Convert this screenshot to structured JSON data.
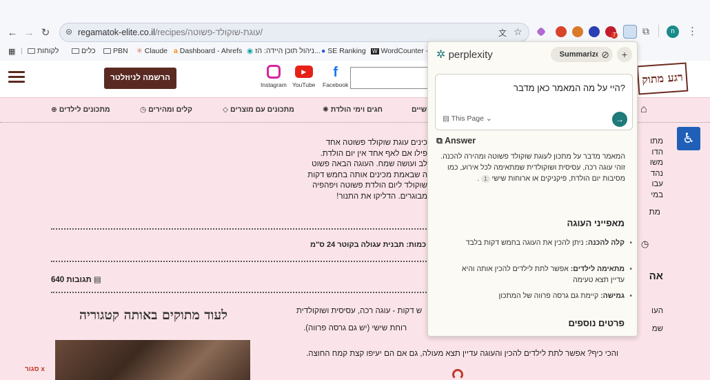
{
  "browser": {
    "url_domain": "regamatok-elite.co.il",
    "url_path": "/recipes/עוגת-שוקולד-פשוטה/",
    "profile_initial": "n",
    "ext_badge": "7",
    "bookmarks": [
      {
        "label": "לקוחות",
        "type": "folder"
      },
      {
        "label": "כלים",
        "type": "folder"
      },
      {
        "label": "PBN",
        "type": "folder"
      },
      {
        "label": "Claude",
        "type": "site"
      },
      {
        "label": "Dashboard - Ahrefs",
        "type": "site"
      },
      {
        "label": "ניהול תוכן היידה: הז...",
        "type": "site"
      },
      {
        "label": "SE Ranking",
        "type": "site"
      },
      {
        "label": "WordCounter - C",
        "type": "site"
      }
    ]
  },
  "site": {
    "signup_label": "הרשמה לניוזלטר",
    "logo_text": "רגע מתוק",
    "social": [
      {
        "label": "Instagram",
        "icon": "instagram-icon",
        "color": "#d6249f"
      },
      {
        "label": "YouTube",
        "icon": "youtube-icon",
        "color": "#e62117"
      },
      {
        "label": "Facebook",
        "icon": "facebook-icon",
        "color": "#1877f2"
      }
    ],
    "categories": [
      {
        "label": "מתכונים לילדים",
        "icon": "kids-icon"
      },
      {
        "label": "קלים ומהירים",
        "icon": "clock-icon"
      },
      {
        "label": "מתכונים עם מוצרים",
        "icon": "diamond-icon"
      },
      {
        "label": "חגים וימי הולדת",
        "icon": "party-icon"
      },
      {
        "label": "שיים",
        "icon": ""
      }
    ],
    "intro_lines": [
      "כינים עוגת שוקולד פשוטה אחד",
      "פילו אם לאף אחד אין יום הולדת.",
      "לב ועושה שמח. העוגה הבאה פשוט",
      "ה שבאמת מכינים אותה בחמש דקות",
      "שוקולד ליום הולדת פשוטה ויפהפיה",
      "מבוגרים. הדליקו את התנור!"
    ],
    "left_edge_lines": [
      "מתו",
      "הדו",
      "משו",
      "נהד",
      "עבו",
      "במי"
    ],
    "edge_mat": "מת",
    "edge_a": "אה",
    "edge_ha": "העו",
    "edge_shm": "שמ",
    "pan_label": "כמות: תבנית עגולה בקוטר 24 ס\"מ",
    "comments_label": "640 תגובות",
    "more_header": "לעוד מתוקים באותה קטגוריה",
    "body_line1": "ש דקות - עוגה רכה, עסיסית ושוקולדית",
    "body_line2": "רוחת שישי (יש גם גרסה פרווה).",
    "body_line3": "והכי כיף? אפשר לתת לילדים להכין והעוגה עדיין תצא מעולה, גם אם הם יעיפו קצת קמח החוצה.",
    "close_label": "סגור x"
  },
  "perplexity": {
    "brand": "perplexity",
    "summarize_label": "Summarize",
    "question": "?היי על מה המאמר כאן מדבר",
    "source_label": "This Page",
    "answer_label": "Answer",
    "answer_text": "המאמר מדבר על מתכון לעוגת שוקולד פשוטה ומהירה להכנה. זוהי עוגה רכה, עסיסית ושוקולדית שמתאימה לכל אירוע, כמו מסיבות יום הולדת, פיקניקים או ארוחות שישי",
    "citation": "1",
    "features_title": "מאפייני העוגה",
    "features": [
      {
        "bold": "קלה להכנה:",
        "text": " ניתן להכין את העוגה בחמש דקות בלבד"
      },
      {
        "bold": "מתאימה לילדים:",
        "text": " אפשר לתת לילדים להכין אותה והיא עדיין תצא טעימה"
      },
      {
        "bold": "גמישה:",
        "text": " קיימת גם גרסה פרווה של המתכון"
      }
    ],
    "more_title": "פרטים נוספים",
    "accent_color": "#1f7a7a"
  }
}
